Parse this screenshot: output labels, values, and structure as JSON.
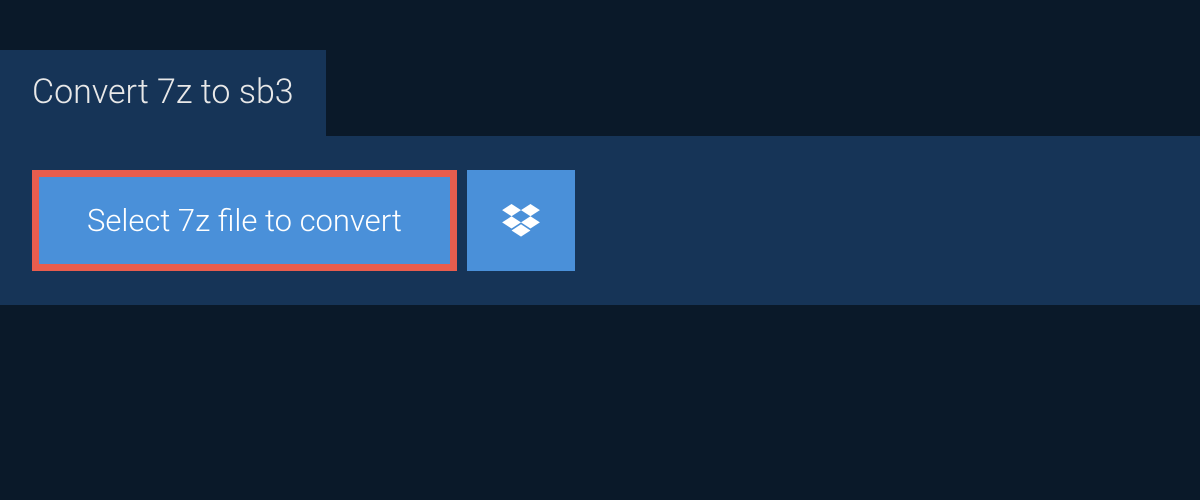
{
  "header": {
    "title": "Convert 7z to sb3"
  },
  "actions": {
    "select_label": "Select 7z file to convert"
  }
}
